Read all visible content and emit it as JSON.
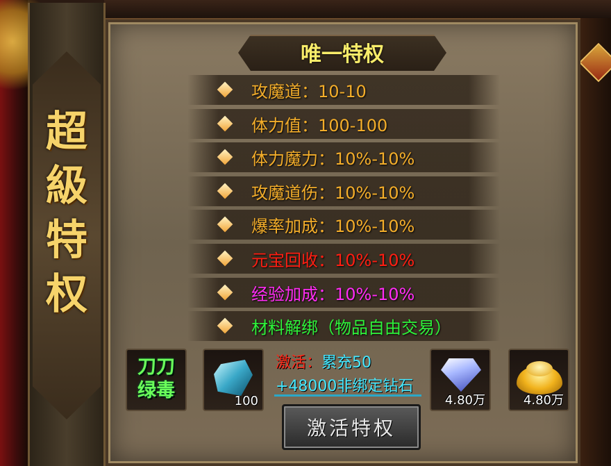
{
  "banner": {
    "chars": [
      "超",
      "級",
      "特",
      "权"
    ]
  },
  "panel": {
    "title": "唯一特权",
    "rows": [
      {
        "text": "攻魔道：10-10",
        "color": "#f3ad2a"
      },
      {
        "text": "体力值：100-100",
        "color": "#f3ad2a"
      },
      {
        "text": "体力魔力：10%-10%",
        "color": "#f3ad2a"
      },
      {
        "text": "攻魔道伤：10%-10%",
        "color": "#f3ad2a"
      },
      {
        "text": "爆率加成：10%-10%",
        "color": "#f3ad2a"
      },
      {
        "text": "元宝回收：10%-10%",
        "color": "#ff1e12"
      },
      {
        "text": "经验加成：10%-10%",
        "color": "#ff2cf4"
      },
      {
        "text": "材料解绑（物品自由交易）",
        "color": "#2ef23a"
      }
    ]
  },
  "rewards": {
    "poison": {
      "line1": "刀刀",
      "line2": "绿毒",
      "icon": "poison-skill-icon"
    },
    "crystal": {
      "count": "100",
      "icon": "crystal-icon"
    },
    "diamond": {
      "count": "4.80万",
      "icon": "diamond-icon"
    },
    "ingot": {
      "count": "4.80万",
      "icon": "gold-ingot-icon"
    }
  },
  "activation": {
    "prefix": "激活：",
    "requirement": "累充50",
    "bonus": "+48000非绑定钻石"
  },
  "activate_button": {
    "label": "激活特权"
  },
  "colors": {
    "gold": "#f3ad2a",
    "red": "#ff1e12",
    "purple": "#ff2cf4",
    "green": "#2ef23a",
    "cyan": "#46e8ff",
    "title": "#f8ec6a"
  }
}
